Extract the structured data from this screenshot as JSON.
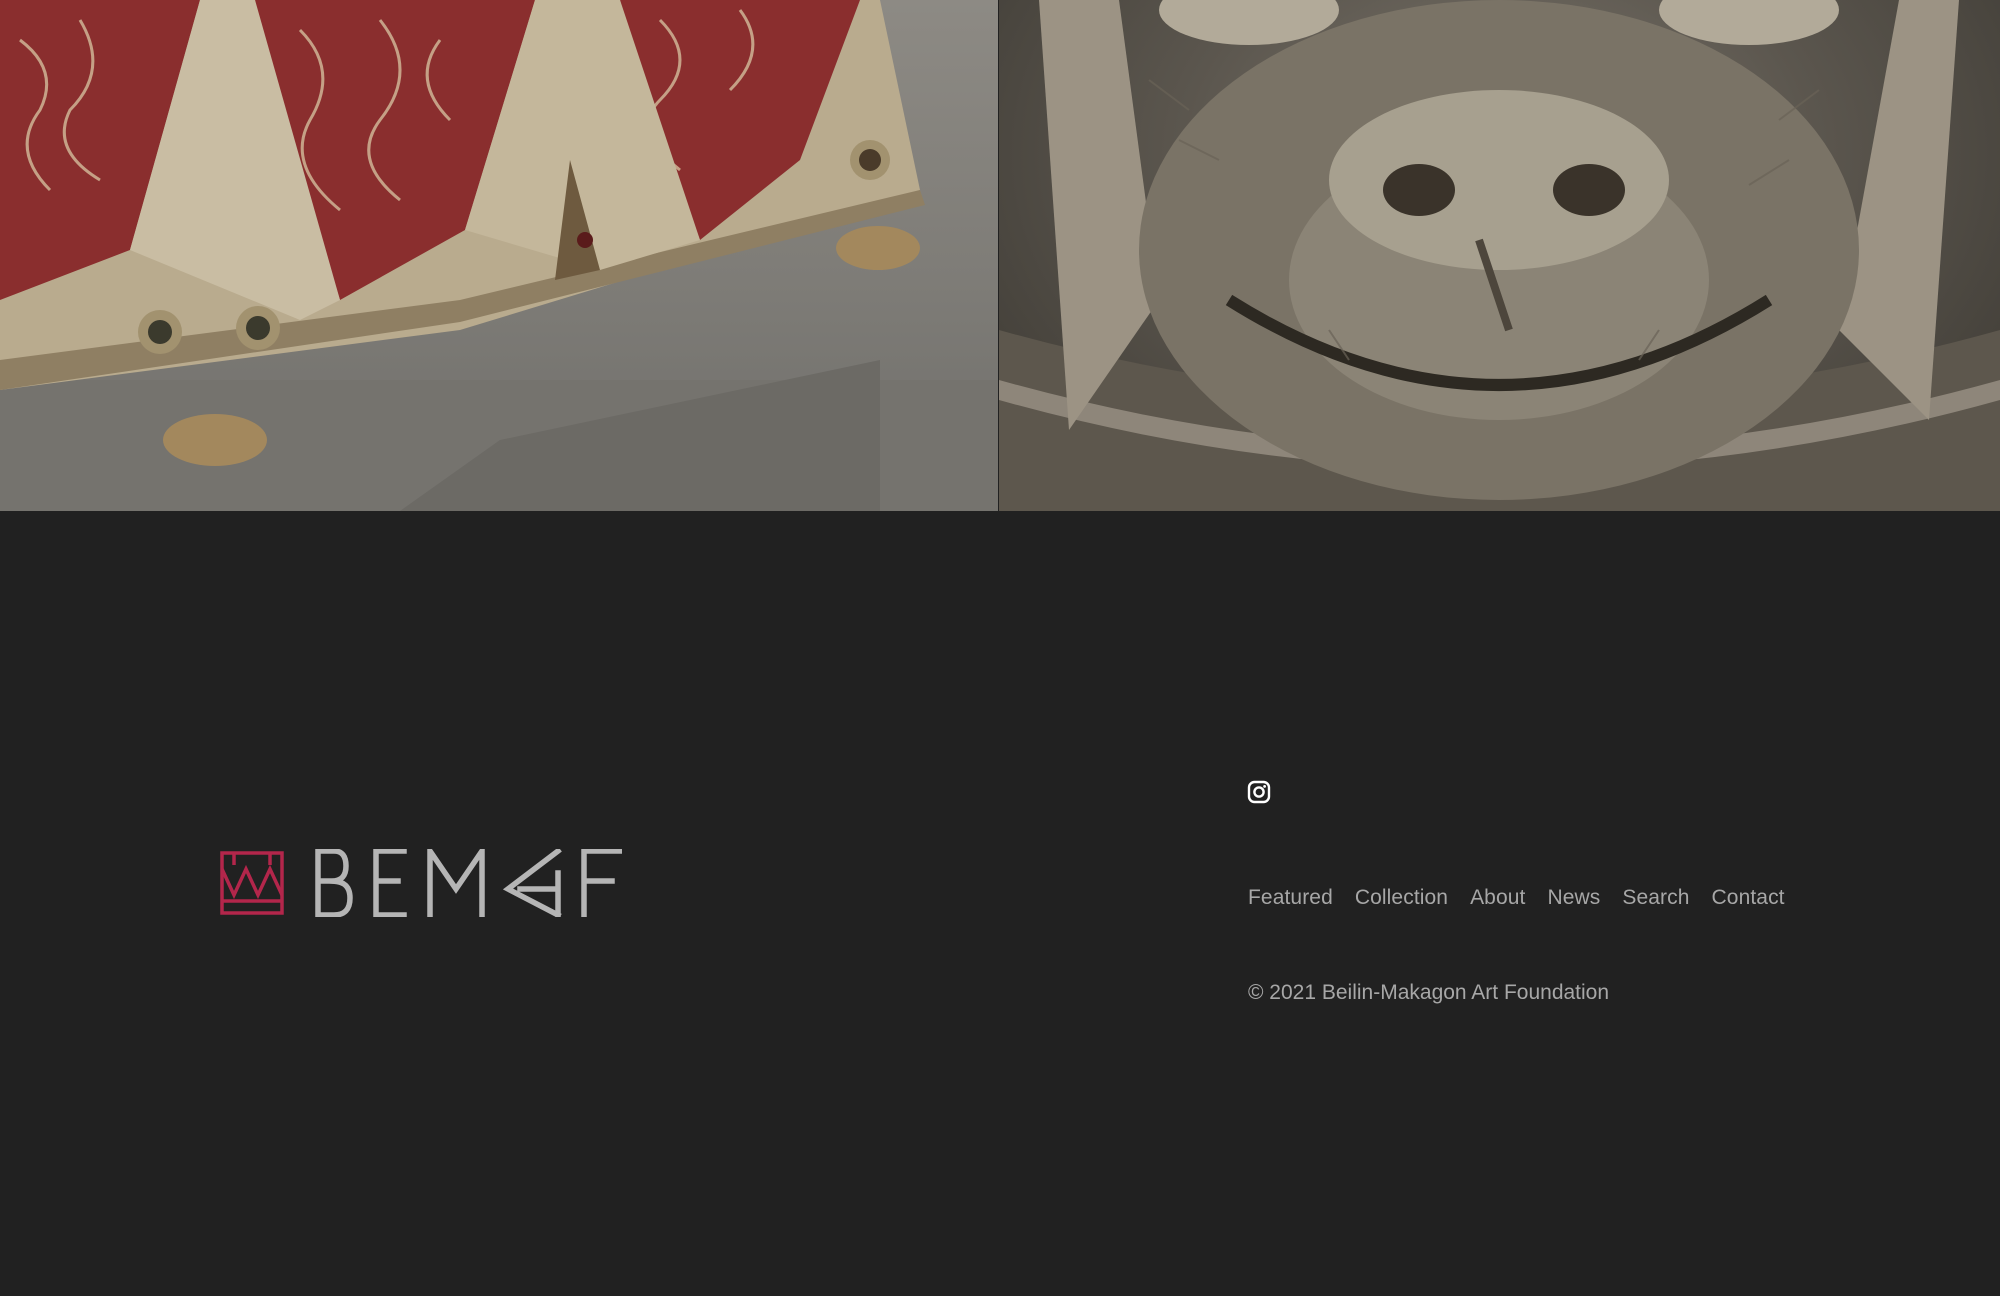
{
  "hero": {
    "left_image": "ornate enamel silver casket with red floral panels",
    "right_image": "silver dog head sculpture close-up"
  },
  "logo": {
    "wordmark": "BEMAF",
    "mark_color": "#b3264b",
    "wordmark_color": "#b5b5b5"
  },
  "social": {
    "icon": "instagram-icon"
  },
  "nav": {
    "items": [
      {
        "label": "Featured"
      },
      {
        "label": "Collection"
      },
      {
        "label": "About"
      },
      {
        "label": "News"
      },
      {
        "label": "Search"
      },
      {
        "label": "Contact"
      }
    ]
  },
  "footer": {
    "copyright": "© 2021 Beilin-Makagon Art Foundation"
  },
  "colors": {
    "background": "#212121",
    "text": "#a7a7a7"
  }
}
